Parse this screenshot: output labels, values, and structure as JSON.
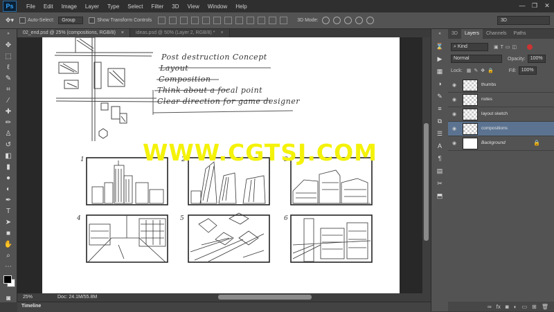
{
  "app": {
    "logo": "Ps"
  },
  "menu": [
    "File",
    "Edit",
    "Image",
    "Layer",
    "Type",
    "Select",
    "Filter",
    "3D",
    "View",
    "Window",
    "Help"
  ],
  "window_controls": [
    "—",
    "❐",
    "✕"
  ],
  "options": {
    "auto_select_label": "Auto-Select:",
    "auto_select_value": "Group",
    "transform_label": "Show Transform Controls",
    "mode3d_label": "3D Mode:",
    "workspace": "3D"
  },
  "tabs": [
    {
      "label": "02_end.psd @ 25% (compositions, RGB/8)",
      "close": "×",
      "active": true
    },
    {
      "label": "ideas.psd @ 50% (Layer 2, RGB/8) *",
      "close": "×",
      "active": false
    }
  ],
  "canvas": {
    "notes": [
      "Post destruction Concept",
      "Layout",
      "Composition",
      "Think about a focal point",
      "Clear direction for game designer"
    ],
    "panel_numbers": [
      "1",
      "2",
      "3",
      "4",
      "5",
      "6"
    ],
    "watermark": "WWW.CGTSJ.COM"
  },
  "status": {
    "zoom": "25%",
    "doc": "Doc: 24.1M/55.8M"
  },
  "timeline": {
    "label": "Timeline"
  },
  "layers_panel": {
    "tabs": [
      "3D",
      "Layers",
      "Channels",
      "Paths"
    ],
    "active_tab": "Layers",
    "filter": "Kind",
    "blend_mode": "Normal",
    "opacity_label": "Opacity:",
    "opacity": "100%",
    "lock_label": "Lock:",
    "fill_label": "Fill:",
    "fill": "100%",
    "layers": [
      {
        "name": "thumbs"
      },
      {
        "name": "notes"
      },
      {
        "name": "layout sketch"
      },
      {
        "name": "compositions",
        "selected": true
      },
      {
        "name": "Background",
        "locked": true
      }
    ]
  },
  "colors": {
    "accent_selected": "#5b7390",
    "watermark": "#f4f20a",
    "ps_blue": "#33a4ff"
  }
}
